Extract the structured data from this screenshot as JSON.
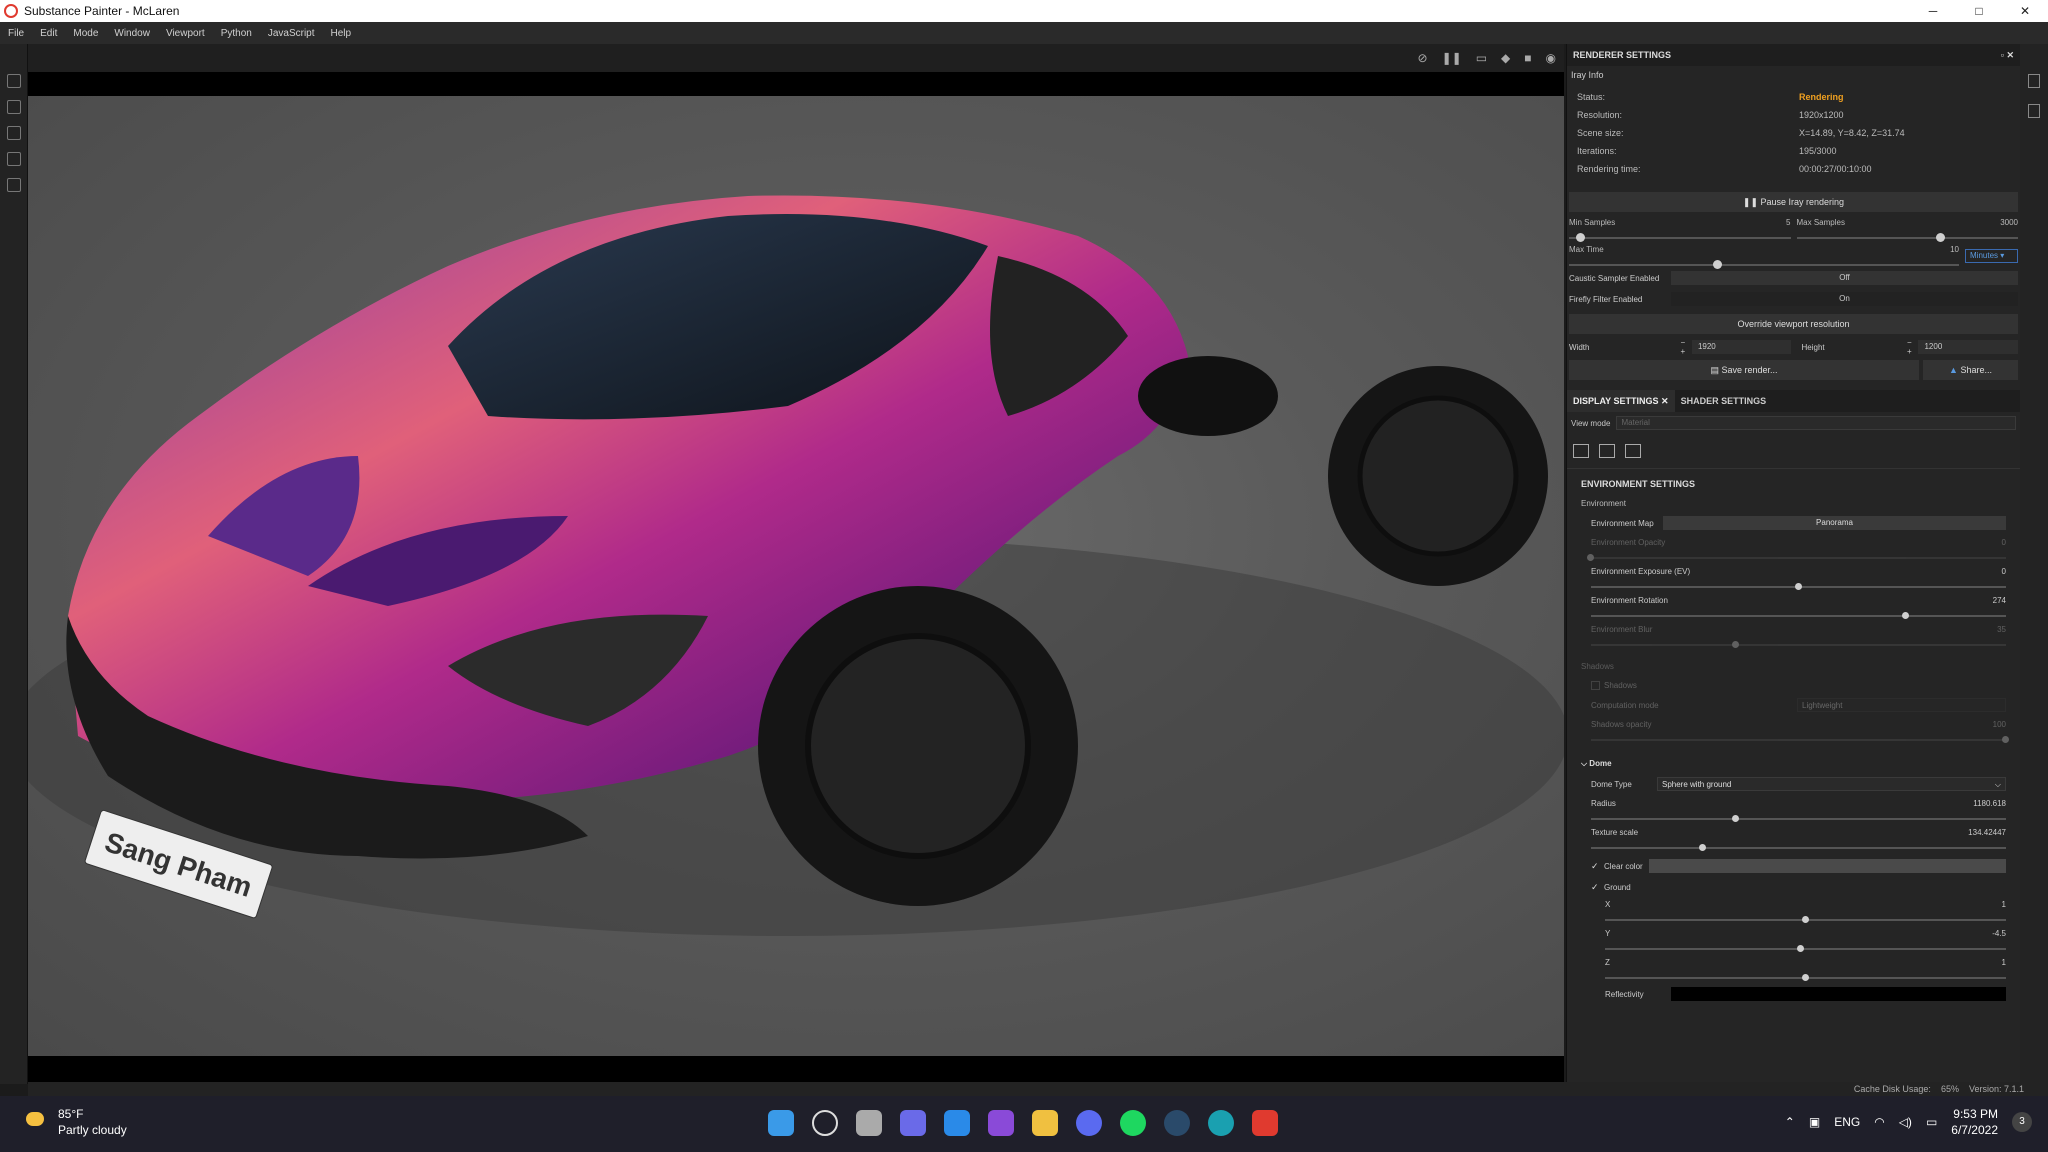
{
  "window": {
    "title": "Substance Painter - McLaren",
    "min": "─",
    "max": "□",
    "close": "✕"
  },
  "menu": [
    "File",
    "Edit",
    "Mode",
    "Window",
    "Viewport",
    "Python",
    "JavaScript",
    "Help"
  ],
  "viewport": {
    "plate_text": "Sang Pham"
  },
  "renderer": {
    "header": "RENDERER SETTINGS",
    "iray_info": "Iray Info",
    "rows": [
      {
        "k": "Status:",
        "v": "Rendering"
      },
      {
        "k": "Resolution:",
        "v": "1920x1200"
      },
      {
        "k": "Scene size:",
        "v": "X=14.89, Y=8.42, Z=31.74"
      },
      {
        "k": "Iterations:",
        "v": "195/3000"
      },
      {
        "k": "Rendering time:",
        "v": "00:00:27/00:10:00"
      }
    ],
    "pause_label": "Pause Iray rendering",
    "min_samples": {
      "label": "Min Samples",
      "value": "5",
      "fraction": 0.05
    },
    "max_samples": {
      "label": "Max Samples",
      "value": "3000",
      "fraction": 0.65
    },
    "max_time": {
      "label": "Max Time",
      "value": "10",
      "fraction": 0.38,
      "unit": "Minutes"
    },
    "caustic": {
      "label": "Caustic Sampler Enabled",
      "value": "Off"
    },
    "firefly": {
      "label": "Firefly Filter Enabled",
      "value": "On"
    },
    "override_label": "Override viewport resolution",
    "width": {
      "label": "Width",
      "value": "1920"
    },
    "height": {
      "label": "Height",
      "value": "1200"
    },
    "save_label": "Save render...",
    "share_label": "Share..."
  },
  "tabs": {
    "display": "DISPLAY SETTINGS",
    "shader": "SHADER SETTINGS"
  },
  "view_mode": {
    "label": "View mode",
    "placeholder": "Material"
  },
  "env": {
    "title": "ENVIRONMENT SETTINGS",
    "environment": "Environment",
    "map_label": "Environment Map",
    "map_value": "Panorama",
    "opacity": {
      "label": "Environment Opacity",
      "value": "0",
      "fraction": 0.0
    },
    "exposure": {
      "label": "Environment Exposure (EV)",
      "value": "0",
      "fraction": 0.5
    },
    "rotation": {
      "label": "Environment Rotation",
      "value": "274",
      "fraction": 0.76
    },
    "blur": {
      "label": "Environment Blur",
      "value": "35",
      "fraction": 0.35
    },
    "shadows_group": "Shadows",
    "shadows_check": "Shadows",
    "computation_label": "Computation mode",
    "computation_value": "Lightweight",
    "shadows_opacity": {
      "label": "Shadows opacity",
      "value": "100",
      "fraction": 1.0
    },
    "dome": "Dome",
    "dome_type_label": "Dome Type",
    "dome_type_value": "Sphere with ground",
    "radius": {
      "label": "Radius",
      "value": "1180.618",
      "fraction": 0.35
    },
    "texture_scale": {
      "label": "Texture scale",
      "value": "134.42447",
      "fraction": 0.27
    },
    "clear_color": "Clear color",
    "ground": "Ground",
    "gx": {
      "label": "X",
      "value": "1",
      "fraction": 0.5
    },
    "gy": {
      "label": "Y",
      "value": "-4.5",
      "fraction": 0.49
    },
    "gz": {
      "label": "Z",
      "value": "1",
      "fraction": 0.5
    },
    "reflectivity": "Reflectivity"
  },
  "status": {
    "cache": "Cache Disk Usage:",
    "cache_value": "65%",
    "version": "Version: 7.1.1"
  },
  "taskbar": {
    "temp": "85°F",
    "weather": "Partly cloudy",
    "lang": "ENG",
    "time": "9:53 PM",
    "date": "6/7/2022",
    "notif": "3"
  }
}
